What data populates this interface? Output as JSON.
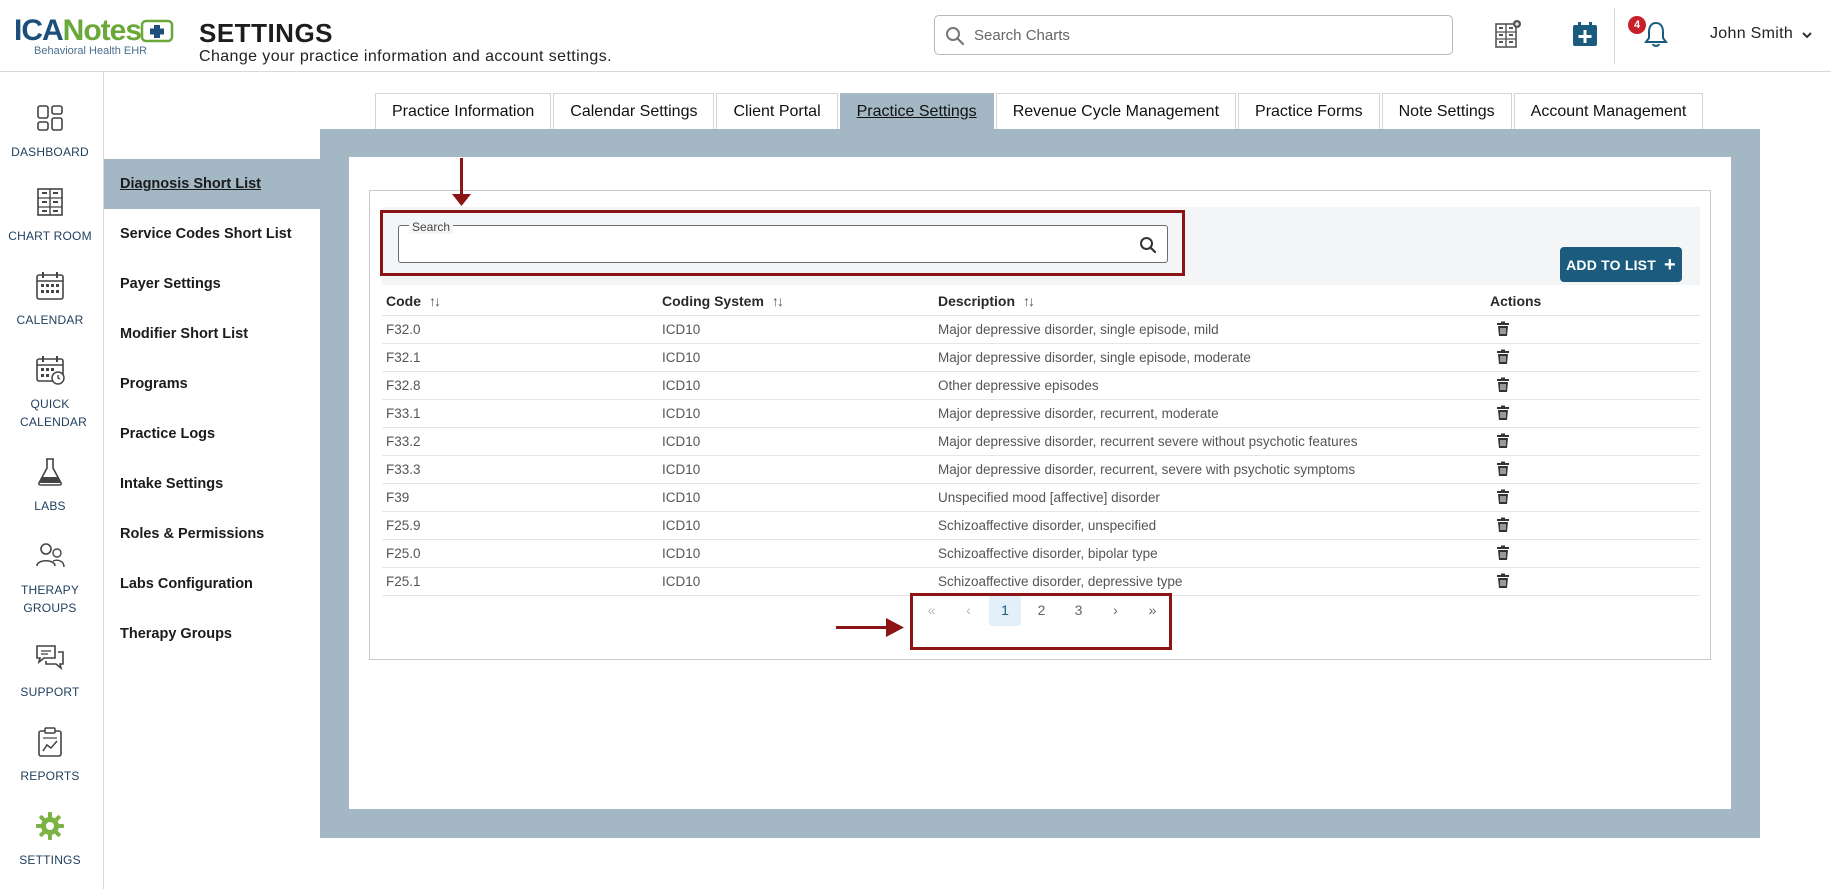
{
  "header": {
    "logo_text_a": "ICA",
    "logo_text_b": "Notes",
    "logo_sub": "Behavioral Health EHR",
    "title": "SETTINGS",
    "subtitle": "Change your practice information and account settings.",
    "search_placeholder": "Search Charts",
    "notification_count": "4",
    "user_name": "John Smith"
  },
  "leftnav": {
    "items": [
      {
        "label": "DASHBOARD",
        "icon": "dashboard-icon"
      },
      {
        "label": "CHART ROOM",
        "icon": "chart-room-icon"
      },
      {
        "label": "CALENDAR",
        "icon": "calendar-icon"
      },
      {
        "label": "QUICK CALENDAR",
        "icon": "quick-calendar-icon"
      },
      {
        "label": "LABS",
        "icon": "flask-icon"
      },
      {
        "label": "THERAPY GROUPS",
        "icon": "groups-icon"
      },
      {
        "label": "SUPPORT",
        "icon": "support-icon"
      },
      {
        "label": "REPORTS",
        "icon": "reports-icon"
      },
      {
        "label": "SETTINGS",
        "icon": "gear-icon"
      }
    ]
  },
  "tabs": [
    {
      "label": "Practice Information"
    },
    {
      "label": "Calendar Settings"
    },
    {
      "label": "Client Portal"
    },
    {
      "label": "Practice Settings",
      "active": true
    },
    {
      "label": "Revenue Cycle Management"
    },
    {
      "label": "Practice Forms"
    },
    {
      "label": "Note Settings"
    },
    {
      "label": "Account Management"
    }
  ],
  "subnav": [
    {
      "label": "Diagnosis Short List",
      "active": true
    },
    {
      "label": "Service Codes Short List"
    },
    {
      "label": "Payer Settings"
    },
    {
      "label": "Modifier Short List"
    },
    {
      "label": "Programs"
    },
    {
      "label": "Practice Logs"
    },
    {
      "label": "Intake Settings"
    },
    {
      "label": "Roles & Permissions"
    },
    {
      "label": "Labs Configuration"
    },
    {
      "label": "Therapy Groups"
    }
  ],
  "list": {
    "search_label": "Search",
    "search_value": "",
    "add_button": "ADD TO LIST",
    "columns": {
      "code": "Code",
      "system": "Coding System",
      "description": "Description",
      "actions": "Actions"
    },
    "rows": [
      {
        "code": "F32.0",
        "system": "ICD10",
        "description": "Major depressive disorder, single episode, mild"
      },
      {
        "code": "F32.1",
        "system": "ICD10",
        "description": "Major depressive disorder, single episode, moderate"
      },
      {
        "code": "F32.8",
        "system": "ICD10",
        "description": "Other depressive episodes"
      },
      {
        "code": "F33.1",
        "system": "ICD10",
        "description": "Major depressive disorder, recurrent, moderate"
      },
      {
        "code": "F33.2",
        "system": "ICD10",
        "description": "Major depressive disorder, recurrent severe without psychotic features"
      },
      {
        "code": "F33.3",
        "system": "ICD10",
        "description": "Major depressive disorder, recurrent, severe with psychotic symptoms"
      },
      {
        "code": "F39",
        "system": "ICD10",
        "description": "Unspecified mood [affective] disorder"
      },
      {
        "code": "F25.9",
        "system": "ICD10",
        "description": "Schizoaffective disorder, unspecified"
      },
      {
        "code": "F25.0",
        "system": "ICD10",
        "description": "Schizoaffective disorder, bipolar type"
      },
      {
        "code": "F25.1",
        "system": "ICD10",
        "description": "Schizoaffective disorder, depressive type"
      }
    ]
  },
  "pager": {
    "first": "«",
    "prev": "‹",
    "pages": [
      "1",
      "2",
      "3"
    ],
    "current": "1",
    "next": "›",
    "last": "»"
  },
  "colors": {
    "accent": "#1b5b7e",
    "panel": "#a4b7c4",
    "annotation": "#8b1414",
    "settings_icon": "#7cb342"
  }
}
